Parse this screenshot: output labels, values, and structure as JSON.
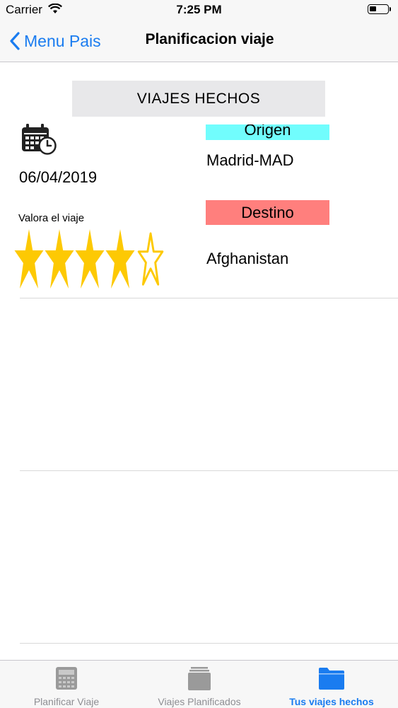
{
  "status_bar": {
    "carrier": "Carrier",
    "time": "7:25 PM"
  },
  "nav": {
    "back_label": "Menu Pais",
    "title": "Planificacion viaje"
  },
  "header": {
    "label": "VIAJES HECHOS"
  },
  "trip": {
    "date": "06/04/2019",
    "rate_label": "Valora el viaje",
    "rating": 4,
    "rating_max": 5,
    "origin_label": "Origen",
    "origin_value": "Madrid-MAD",
    "destination_label": "Destino",
    "destination_value": "Afghanistan"
  },
  "tabs": [
    {
      "label": "Planificar Viaje",
      "icon": "calculator-icon",
      "active": false
    },
    {
      "label": "Viajes Planificados",
      "icon": "stack-icon",
      "active": false
    },
    {
      "label": "Tus viajes hechos",
      "icon": "folder-icon",
      "active": true
    }
  ],
  "colors": {
    "accent": "#1a7cf0",
    "origin_bg": "#71fdfd",
    "destination_bg": "#ff7f7d",
    "star": "#fdc903"
  }
}
